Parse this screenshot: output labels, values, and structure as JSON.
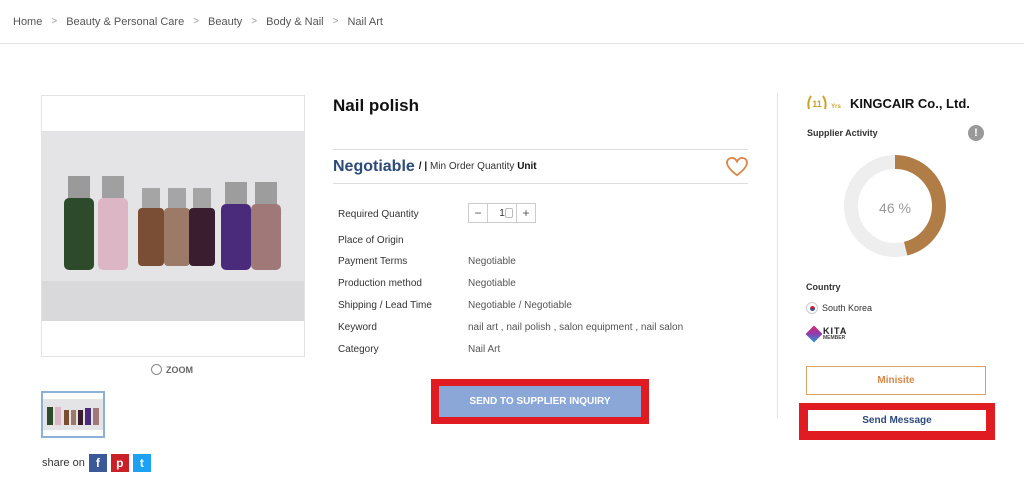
{
  "breadcrumb": {
    "items": [
      "Home",
      "Beauty & Personal Care",
      "Beauty",
      "Body & Nail",
      "Nail Art"
    ],
    "separator": ">"
  },
  "gallery": {
    "zoom_label": "ZOOM",
    "share_label": "share on",
    "social": [
      {
        "name": "facebook-icon",
        "glyph": "f",
        "color": "#3b5998"
      },
      {
        "name": "pinterest-icon",
        "glyph": "p",
        "color": "#cb2027"
      },
      {
        "name": "twitter-icon",
        "glyph": "t",
        "color": "#1da1f2"
      }
    ]
  },
  "product": {
    "title": "Nail polish",
    "price": "Negotiable",
    "price_sep": "/ |",
    "moq_label": "Min Order Quantity",
    "moq_unit": "Unit",
    "quantity": "1",
    "specs": [
      {
        "label": "Required Quantity",
        "value": ""
      },
      {
        "label": "Place of Origin",
        "value": ""
      },
      {
        "label": "Payment Terms",
        "value": "Negotiable"
      },
      {
        "label": "Production method",
        "value": "Negotiable"
      },
      {
        "label": "Shipping / Lead Time",
        "value": "Negotiable / Negotiable"
      },
      {
        "label": "Keyword",
        "value": "nail art , nail polish , salon equipment , nail salon"
      },
      {
        "label": "Category",
        "value": "Nail Art"
      }
    ],
    "inquiry_button": "SEND TO SUPPLIER INQUIRY"
  },
  "supplier": {
    "years": "11",
    "years_suffix": "Yrs",
    "name": "KINGCAIR Co., Ltd.",
    "activity_label": "Supplier Activity",
    "activity_percent": 46,
    "activity_text": "46 %",
    "country_label": "Country",
    "country": "South Korea",
    "kita_line1": "KITA",
    "kita_line2": "MEMBER",
    "minisite_button": "Minisite",
    "message_button": "Send Message"
  },
  "colors": {
    "accent_blue": "#2c4a7a",
    "donut_fill": "#b07d46",
    "donut_track": "#eeeeee",
    "highlight_red": "#e11b22"
  }
}
